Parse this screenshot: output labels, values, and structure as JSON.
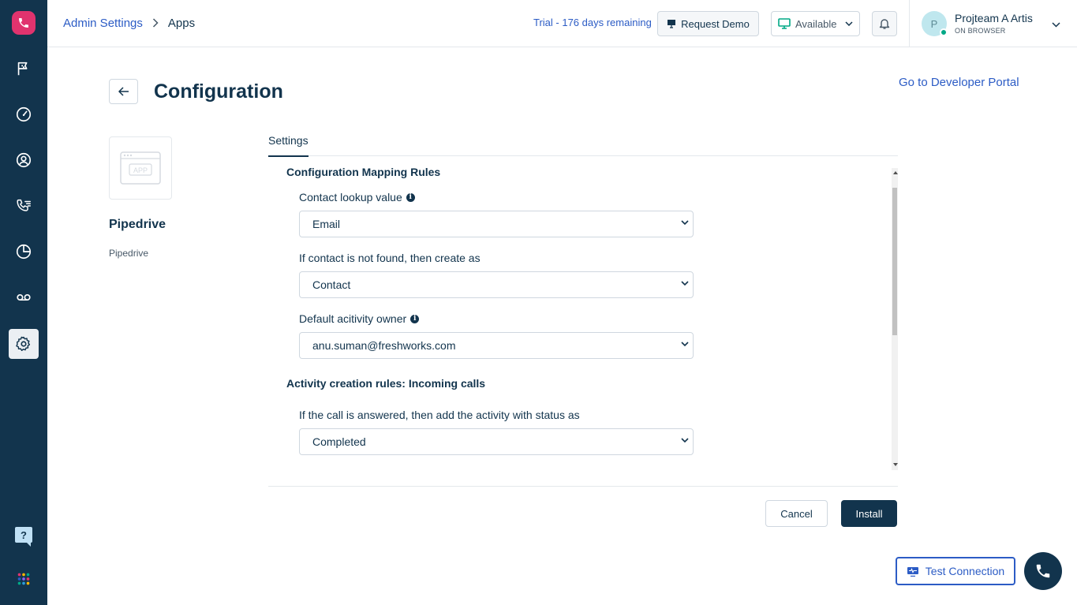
{
  "header": {
    "breadcrumb_root": "Admin Settings",
    "breadcrumb_current": "Apps",
    "trial_text": "Trial - 176 days remaining",
    "request_demo_label": "Request Demo",
    "status_value": "Available",
    "user_initial": "P",
    "user_name": "Projteam A Artis",
    "user_status": "ON BROWSER"
  },
  "page": {
    "title": "Configuration",
    "developer_link": "Go to Developer Portal",
    "app_name": "Pipedrive",
    "app_subtitle": "Pipedrive",
    "app_logo_text": "APP"
  },
  "tabs": [
    {
      "label": "Settings",
      "active": true
    }
  ],
  "form": {
    "section_mapping": "Configuration Mapping Rules",
    "contact_lookup_label": "Contact lookup value",
    "contact_lookup_value": "Email",
    "not_found_label": "If contact is not found, then create as",
    "not_found_value": "Contact",
    "owner_label": "Default acitivity owner",
    "owner_value": "anu.suman@freshworks.com",
    "section_incoming": "Activity creation rules: Incoming calls",
    "answered_label": "If the call is answered, then add the activity with status as",
    "answered_value": "Completed"
  },
  "footer": {
    "cancel_label": "Cancel",
    "install_label": "Install",
    "test_connection_label": "Test Connection"
  },
  "help_label": "?",
  "colors": {
    "sidebar": "#12344d",
    "accent": "#2c5cc5",
    "logo": "#e0336e",
    "available": "#00a886"
  }
}
